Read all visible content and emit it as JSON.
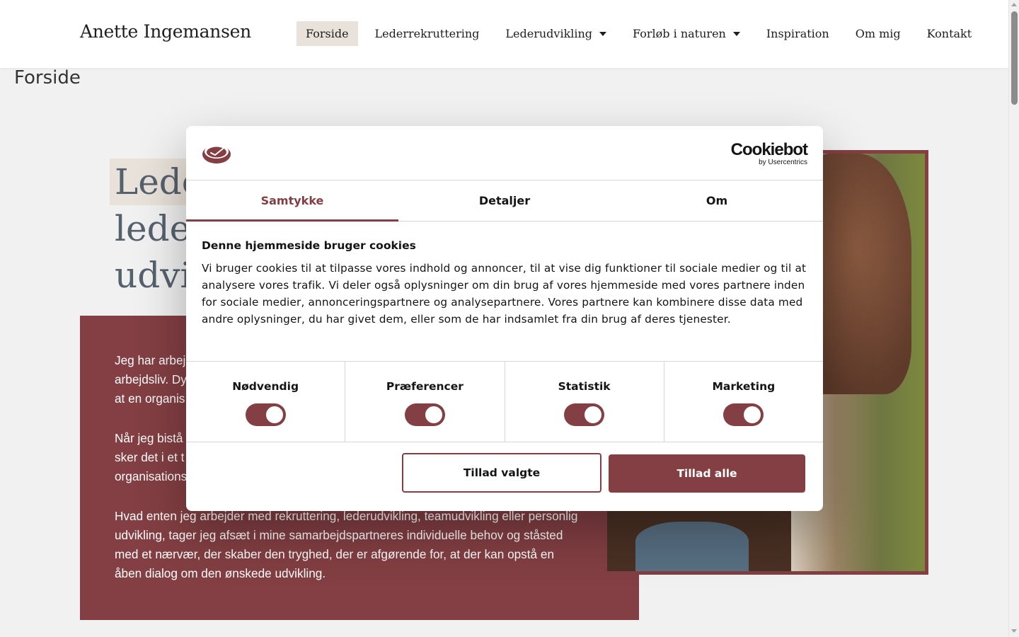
{
  "header": {
    "brand": "Anette Ingemansen",
    "nav": [
      {
        "label": "Forside",
        "active": true,
        "dropdown": false
      },
      {
        "label": "Lederrekruttering",
        "active": false,
        "dropdown": false
      },
      {
        "label": "Lederudvikling",
        "active": false,
        "dropdown": true
      },
      {
        "label": "Forløb i naturen",
        "active": false,
        "dropdown": true
      },
      {
        "label": "Inspiration",
        "active": false,
        "dropdown": false
      },
      {
        "label": "Om mig",
        "active": false,
        "dropdown": false
      },
      {
        "label": "Kontakt",
        "active": false,
        "dropdown": false
      }
    ]
  },
  "page": {
    "title": "Forside",
    "hero_lines": [
      "Lede",
      "leder",
      "udvi"
    ],
    "paragraphs": [
      "Jeg har arbejdet med ledere og medarbejdere i mange år med fokus på udvikling i arbejdsliv. Dy at en organis",
      "Når jeg bistår sker det i et t organisations",
      "Hvad enten jeg arbejder med rekruttering, lederudvikling, teamudvikling eller personlig udvikling, tager jeg afsæt i mine samarbejdspartneres individuelle behov og ståsted med et nærvær, der skaber den tryghed, der er afgørende for, at der kan opstå en åben dialog om den ønskede udvikling."
    ],
    "paragraph_visible": [
      "Jeg har arbej\narbejdsliv. Dy\nat en organis",
      "Når jeg bistå\nsker det i et t\norganisations",
      "Hvad enten jeg arbejder med rekruttering, lederudvikling, teamudvikling eller personlig udvikling, tager jeg afsæt i mine samarbejdspartneres individuelle behov og ståsted med et nærvær, der skaber den tryghed, der er afgørende for, at der kan opstå en åben dialog om den ønskede udvikling."
    ]
  },
  "cookie_dialog": {
    "brand": "Cookiebot",
    "brand_sub": "by Usercentrics",
    "tabs": [
      {
        "label": "Samtykke",
        "active": true
      },
      {
        "label": "Detaljer",
        "active": false
      },
      {
        "label": "Om",
        "active": false
      }
    ],
    "title": "Denne hjemmeside bruger cookies",
    "text": "Vi bruger cookies til at tilpasse vores indhold og annoncer, til at vise dig funktioner til sociale medier og til at analysere vores trafik. Vi deler også oplysninger om din brug af vores hjemmeside med vores partnere inden for sociale medier, annonceringspartnere og analysepartnere. Vores partnere kan kombinere disse data med andre oplysninger, du har givet dem, eller som de har indsamlet fra din brug af deres tjenester.",
    "categories": [
      {
        "label": "Nødvendig",
        "enabled": true
      },
      {
        "label": "Præferencer",
        "enabled": true
      },
      {
        "label": "Statistik",
        "enabled": true
      },
      {
        "label": "Marketing",
        "enabled": true
      }
    ],
    "btn_allow_selected": "Tillad valgte",
    "btn_allow_all": "Tillad alle"
  },
  "colors": {
    "accent": "#833f43",
    "highlight": "#e9e2da",
    "heading": "#55616d"
  }
}
